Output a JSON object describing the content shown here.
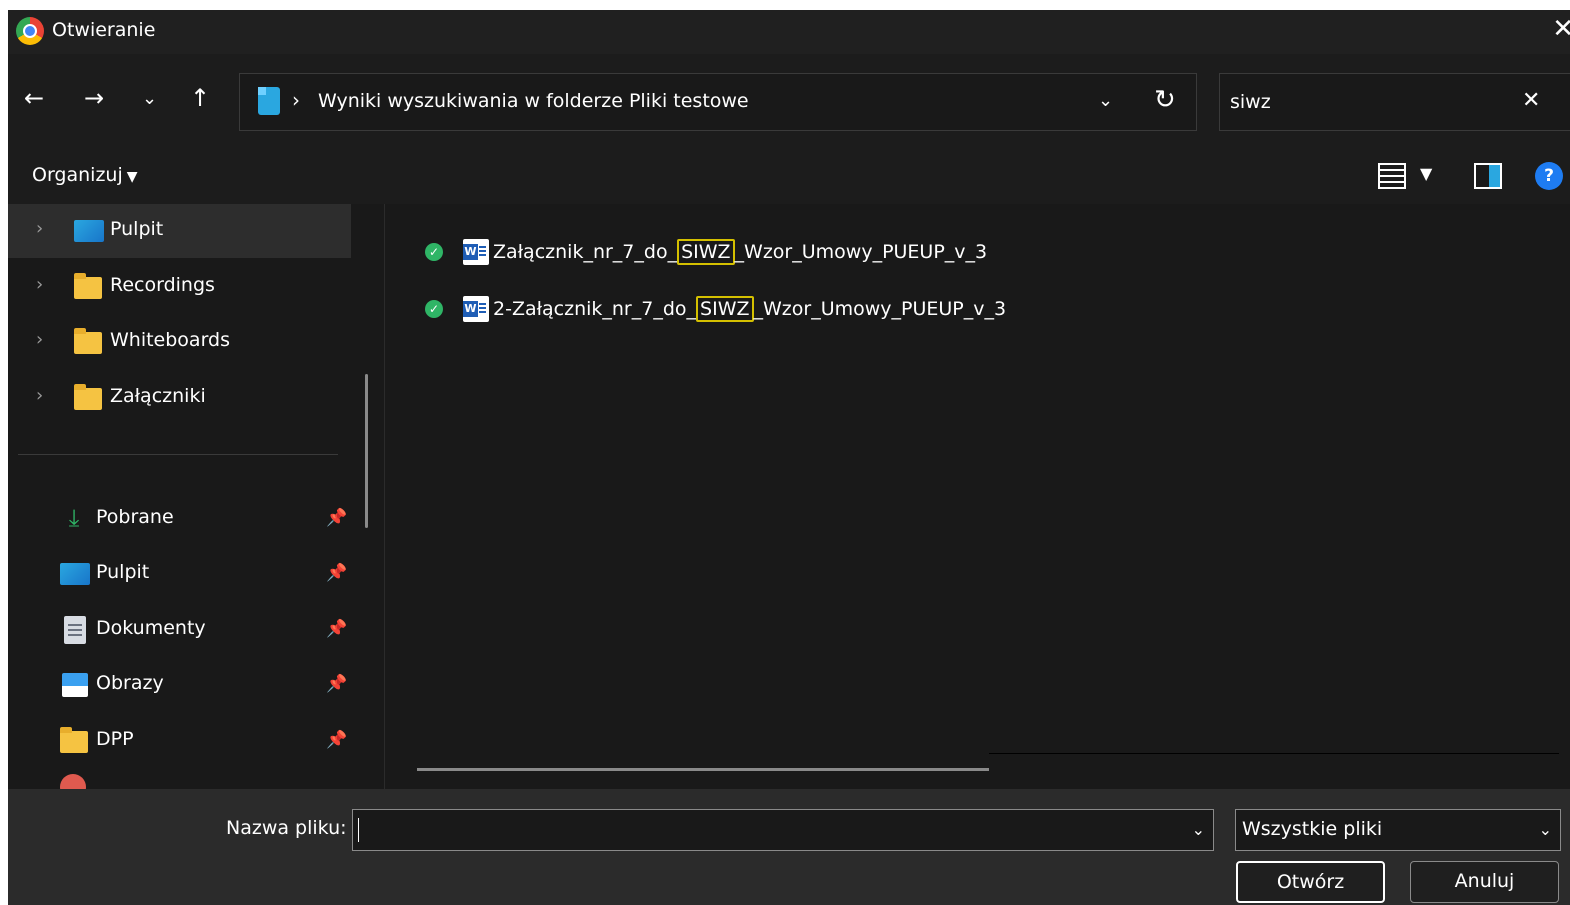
{
  "window": {
    "title": "Otwieranie"
  },
  "nav": {
    "address": "Wyniki wyszukiwania w folderze Pliki testowe",
    "search_value": "siwz"
  },
  "toolbar": {
    "organize_label": "Organizuj"
  },
  "sidebar": {
    "tree_items": [
      {
        "label": "Pulpit",
        "icon": "desktop-icon",
        "selected": true
      },
      {
        "label": "Recordings",
        "icon": "folder-icon"
      },
      {
        "label": "Whiteboards",
        "icon": "folder-icon"
      },
      {
        "label": "Załączniki",
        "icon": "folder-icon"
      }
    ],
    "quick_access": [
      {
        "label": "Pobrane",
        "icon": "download-icon"
      },
      {
        "label": "Pulpit",
        "icon": "desktop-icon"
      },
      {
        "label": "Dokumenty",
        "icon": "documents-icon"
      },
      {
        "label": "Obrazy",
        "icon": "pictures-icon"
      },
      {
        "label": "DPP",
        "icon": "folder-icon"
      }
    ]
  },
  "files": [
    {
      "prefix": "Załącznik_nr_7_do_",
      "highlight": "SIWZ",
      "suffix": "_Wzor_Umowy_PUEUP_v_3",
      "icon": "word-doc-icon",
      "status": "synced-check-icon"
    },
    {
      "prefix": "2-Załącznik_nr_7_do_",
      "highlight": "SIWZ",
      "suffix": "_Wzor_Umowy_PUEUP_v_3",
      "icon": "word-doc-icon",
      "status": "synced-check-icon"
    }
  ],
  "footer": {
    "filename_label": "Nazwa pliku:",
    "filename_value": "",
    "filetype_value": "Wszystkie pliki",
    "open_label": "Otwórz",
    "cancel_label": "Anuluj"
  },
  "colors": {
    "background": "#191919",
    "titlebar": "#202020",
    "footer": "#2b2b2b",
    "highlight_border": "#d4c000",
    "accent": "#1e7cf2"
  }
}
